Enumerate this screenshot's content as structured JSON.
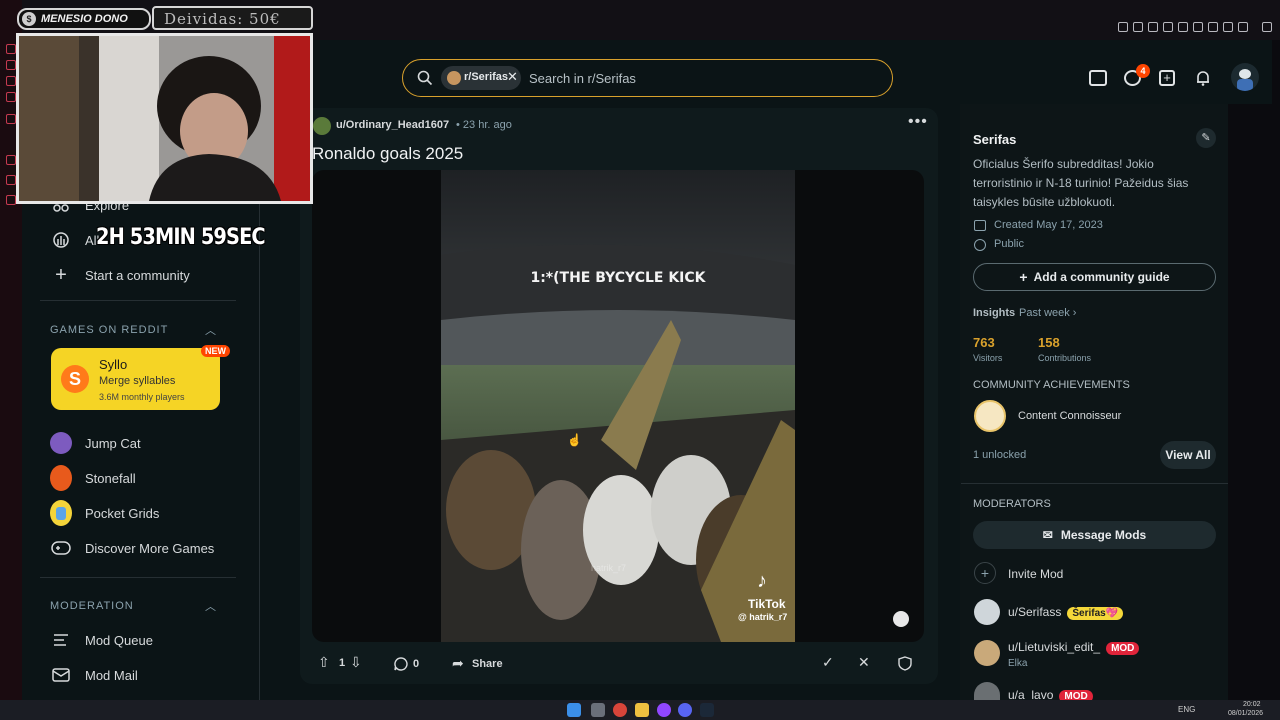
{
  "stream": {
    "channel_name": "MENESIO DONO",
    "debt_label": "Deividas: 50€",
    "timer": "2H 53MIN 59SEC"
  },
  "header": {
    "search_chip": "r/Serifas",
    "search_placeholder": "Search in r/Serifas",
    "chat_badge": "4"
  },
  "sidebar": {
    "items": [
      {
        "label": "Explore",
        "icon": "explore-icon"
      },
      {
        "label": "All",
        "icon": "all-icon"
      },
      {
        "label": "Start a community",
        "icon": "plus-icon"
      }
    ],
    "games_title": "GAMES ON REDDIT",
    "featured_game": {
      "name": "Syllo",
      "subtitle": "Merge syllables",
      "players": "3.6M monthly players",
      "badge": "NEW"
    },
    "games": [
      {
        "label": "Jump Cat"
      },
      {
        "label": "Stonefall"
      },
      {
        "label": "Pocket Grids"
      },
      {
        "label": "Discover More Games"
      }
    ],
    "moderation_title": "MODERATION",
    "moderation_items": [
      {
        "label": "Mod Queue"
      },
      {
        "label": "Mod Mail"
      }
    ]
  },
  "post": {
    "author": "u/Ordinary_Head1607",
    "time": "• 23 hr. ago",
    "title": "Ronaldo goals 2025",
    "video_caption": "1:*(THE BYCYCLE KICK",
    "watermark_name": "TikTok",
    "watermark_user": "@ hatrik_r7",
    "handle_faint": "hatrik_r7",
    "votes": "1",
    "comments": "0",
    "share_label": "Share"
  },
  "community": {
    "name": "Serifas",
    "description": "Oficialus Šerifo subredditas! Jokio terroristinio ir N-18 turinio! Pažeidus šias taisykles būsite užblokuoti.",
    "created": "Created May 17, 2023",
    "visibility": "Public",
    "guide_button": "Add a community guide",
    "insights_label": "Insights",
    "insights_period": "Past week",
    "visitors_value": "763",
    "visitors_label": "Visitors",
    "contrib_value": "158",
    "contrib_label": "Contributions",
    "achievements_title": "COMMUNITY ACHIEVEMENTS",
    "achievement_name": "Content Connoisseur",
    "unlocked": "1 unlocked",
    "view_all": "View All",
    "moderators_title": "MODERATORS",
    "message_mods": "Message Mods",
    "invite_mod": "Invite Mod",
    "mods": [
      {
        "name": "u/Serifass",
        "flair": "Šerifas💖",
        "flair_color": "#f5d83a",
        "sub": ""
      },
      {
        "name": "u/Lietuviski_edit_",
        "flair": "MOD",
        "flair_color": "#e0243a",
        "sub": "Elka"
      },
      {
        "name": "u/a_lavo",
        "flair": "MOD",
        "flair_color": "#e0243a",
        "sub": ""
      }
    ]
  },
  "taskbar": {
    "lang": "ENG",
    "time": "20:02",
    "date": "08/01/2026"
  },
  "colors": {
    "accent_orange": "#d9a12c",
    "syllo_yellow": "#f5d425",
    "new_badge": "#ff4500"
  }
}
